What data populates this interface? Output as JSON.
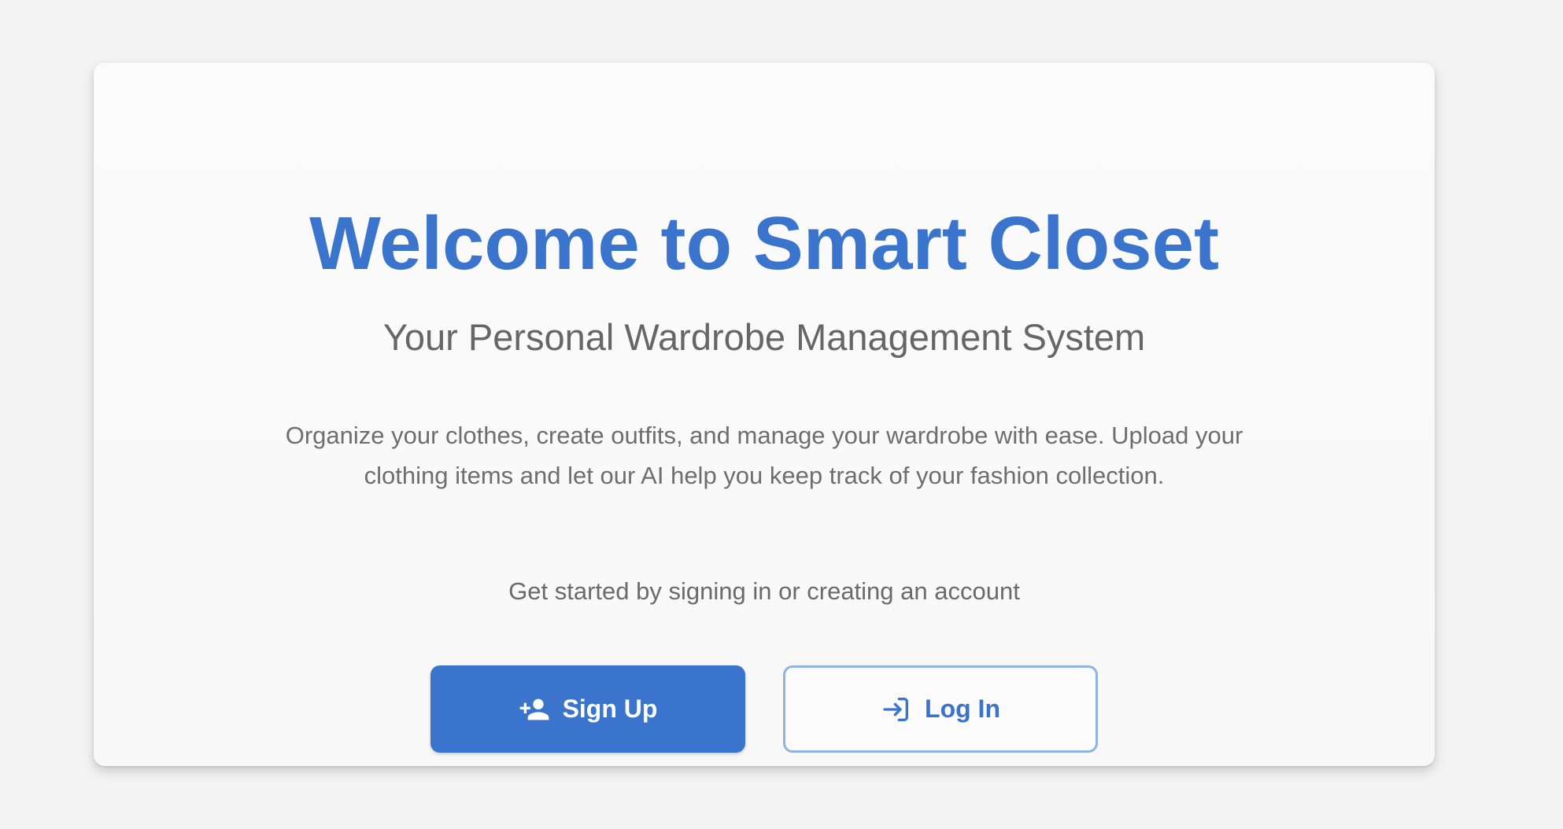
{
  "welcome": {
    "title": "Welcome to Smart Closet",
    "subtitle": "Your Personal Wardrobe Management System",
    "description": "Organize your clothes, create outfits, and manage your wardrobe with ease. Upload your clothing items and let our AI help you keep track of your fashion collection.",
    "cta_text": "Get started by signing in or creating an account"
  },
  "buttons": {
    "signup": {
      "label": "Sign Up",
      "icon": "person-add-icon"
    },
    "login": {
      "label": "Log In",
      "icon": "login-icon"
    }
  },
  "colors": {
    "accent": "#3a74cc",
    "outline_border": "#8fb3e3",
    "background": "#f3f3f3",
    "card": "#fafafa",
    "subtitle_text": "#666666"
  }
}
